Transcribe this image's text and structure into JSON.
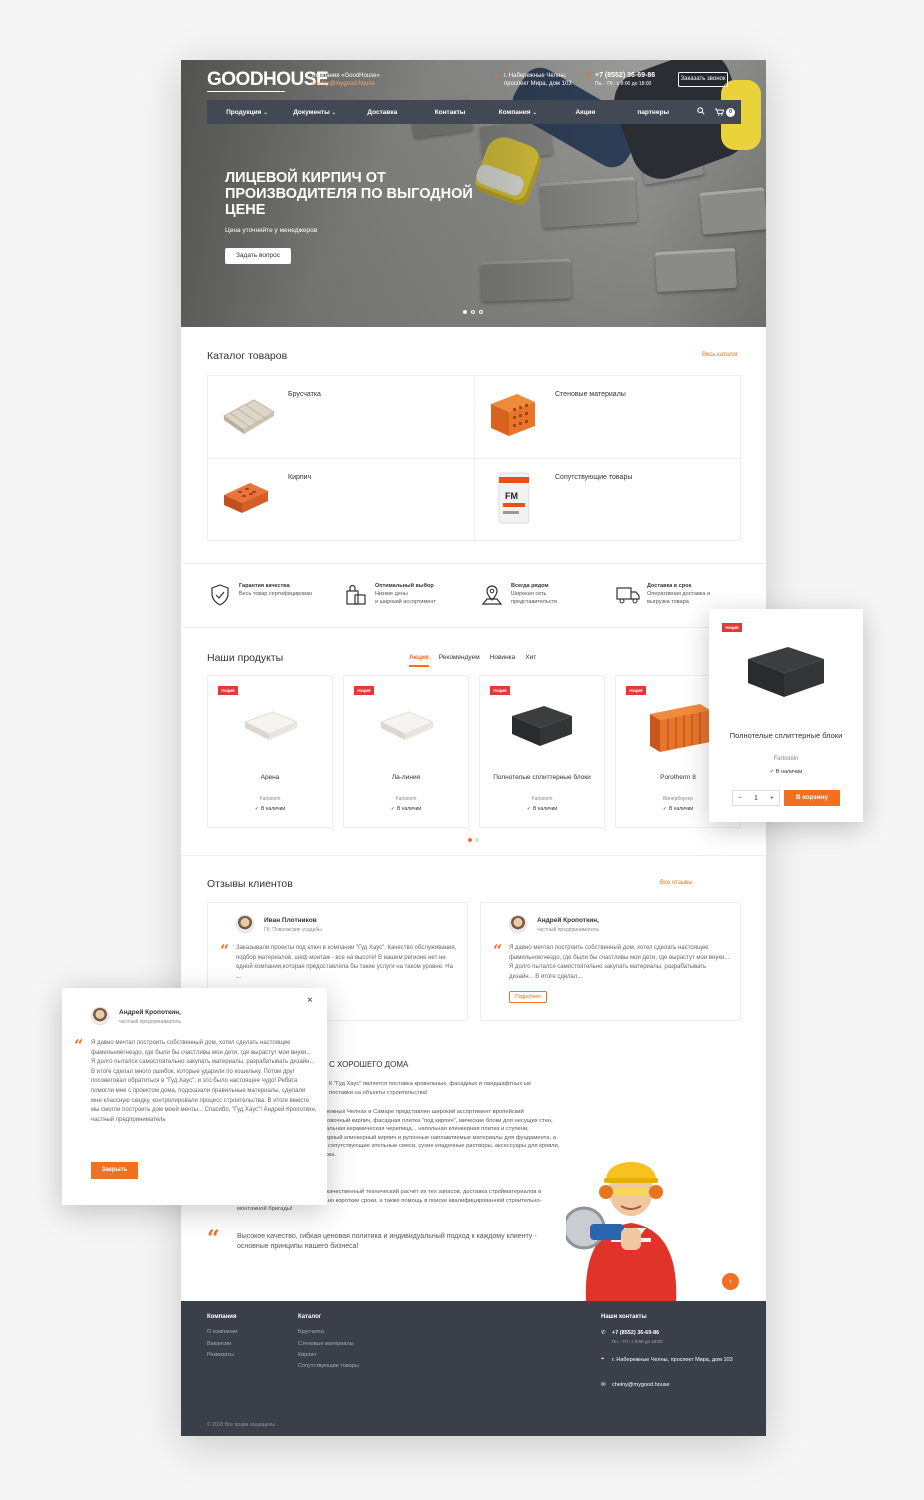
{
  "header": {
    "logo": "GOODHOUSE",
    "company": "Компания «GoodHouse»",
    "email": "chelny@mygood.house",
    "address_line1": "г. Набережные Челны,",
    "address_line2": "проспект Мира, дом 103",
    "phone": "+7 (8552) 36-69-86",
    "hours": "Пн. - Пт.: с 9:00 до 18:00",
    "call_button": "Заказать звонок",
    "cart_count": "0"
  },
  "nav": {
    "items": [
      "Продукция",
      "Документы",
      "Доставка",
      "Контакты",
      "Компания",
      "Акции",
      "партнеры"
    ],
    "dropdown_mark": "⌄"
  },
  "hero": {
    "title": "ЛИЦЕВОЙ КИРПИЧ ОТ ПРОИЗВОДИТЕЛЯ ПО ВЫГОДНОЙ ЦЕНЕ",
    "subtitle": "Цена уточняйте у менеджеров",
    "button": "Задать вопрос"
  },
  "catalog": {
    "title": "Каталог товаров",
    "all_link": "Весь каталог",
    "items": [
      "Брусчатка",
      "Стеновые материалы",
      "Кирпич",
      "Сопутствующие товары"
    ]
  },
  "features": [
    {
      "title": "Гарантия качества",
      "text1": "Весь товар сертифицирован",
      "text2": ""
    },
    {
      "title": "Оптимальный выбор",
      "text1": "Низкие цены",
      "text2": "и широкий ассортимент"
    },
    {
      "title": "Всегда рядом",
      "text1": "Широкая сеть",
      "text2": "представительств"
    },
    {
      "title": "Доставка в срок",
      "text1": "Оперативная доставка и",
      "text2": "выгрузка товара"
    }
  ],
  "products": {
    "title": "Наши продукты",
    "tabs": [
      "Акция",
      "Рекомендуем",
      "Новинка",
      "Хит"
    ],
    "badge": "Акция",
    "in_stock": "В наличии",
    "items": [
      {
        "name": "Арена",
        "brand": "Farbstein"
      },
      {
        "name": "Ла-линия",
        "brand": "Farbstein"
      },
      {
        "name": "Полнотелые сплиттерные блоки",
        "brand": "Farbstein"
      },
      {
        "name": "Porotherm 8",
        "brand": "Винербергер"
      }
    ]
  },
  "popup_product": {
    "badge": "Акция",
    "name": "Полнотелые сплиттерные блоки",
    "brand": "Farbstein",
    "stock": "В наличии",
    "qty": "1",
    "minus": "−",
    "plus": "+",
    "button": "В корзину"
  },
  "reviews": {
    "title": "Отзывы клиентов",
    "all_link": "Все отзывы",
    "more": "Подробнее",
    "items": [
      {
        "name": "Иван Плотников",
        "role": "ГК: Поволжские усадьбы",
        "text": "Заказывали проекты под ключ в компании \"Гуд Хаус\". Качество обслуживания, подбор материалов, шеф монтаж - все на высоте! В нашем регионе нет ни одной компании,которая предоставляла бы такие услуги на таком уровне. На ..."
      },
      {
        "name": "Андрей Кропоткин,",
        "role": "частный предприниматель",
        "text": "Я давно мечтал построить собственный дом, хотел сделать настоящее фамильноегнездо, где были бы счастливы мои дети, где вырастут мои внуки... Я долго пытался самостоятельно закупать материалы, разрабатывать дизайн... В итоге сделал..."
      }
    ]
  },
  "modal": {
    "name": "Андрей Кропоткин,",
    "role": "частный предприниматель",
    "text": "Я давно мечтал построить собственный дом, хотел сделать настоящее фамильноегнездо, где были бы счастливы мои дети, где вырастут мои внуки... Я долго пытался самостоятельно закупать материалы, разрабатывать дизайн... В итоге сделал много ошибок, которые ударили по кошельку. Потом друг посоветовал обратиться в \"Гуд Хаус\", и это было настоящее чудо! Ребята помогли мне с проектом дома, подсказали правильные материалы, сделали мне классную скидку, контролировали процесс строительства. В итоге вместе мы смогли построить дом моей мечты... Спасибо, \"Гуд Хаус\"! Андрей Кропоткин, частный предприниматель",
    "close_button": "Закрыть",
    "close_x": "×"
  },
  "about": {
    "title": "С ХОРОШЕГО ДОМА",
    "p1": "К \"Гуд Хаус\" является поставка кровельных, фасадных и ландшафтных ые поставки на объекты строительства!",
    "p2": "Набережных Челнах и Самаре представлен широкий ассортимент вропейский облицовочный кирпич, фасадная плитка \"под кирпич\", мические блоки для несущих стен, натуральная керамическая черепица, , напольная клинкерная плитка и ступени, тротуарный клинкерный кирпич и рулонные наплавляемые материалы для фундамента, а также сопутствующие ительные смеси, сухие кладочные растворы, аксессуары для кровли, монтажа.",
    "p3": "для клиентов Гуд Хаус являются качественный технический расчёт их тех запасов, доставка стройматериалов в любую точку России в максимально короткие сроки, а также помощь в поиске квалифицированной строительно-монтажной бригады!",
    "quote": "Высокое качество, гибкая ценовая политика и индивидуальный подход к каждому клиенту - основные принципы нашего бизнеса!"
  },
  "footer": {
    "col1_title": "Компания",
    "col1": [
      "О компании",
      "Вакансии",
      "Реквизиты"
    ],
    "col2_title": "Каталог",
    "col2": [
      "Брусчатка",
      "Стеновые материалы",
      "Кирпич",
      "Сопутствующие товары"
    ],
    "col3_title": "Наши контакты",
    "phone": "+7 (8552) 36-69-86",
    "hours": "Пн. - Пт.: с 9:00 до 18:00",
    "address": "г. Набережные Челны, проспект Мира, дом 103",
    "email": "chelny@mygood.house",
    "copyright": "© 2018 Все права защищены."
  },
  "colors": {
    "accent": "#f36f21",
    "nav_bg": "#434855",
    "footer_bg": "#3a3f4a",
    "sale_badge": "#e53935"
  },
  "icons": [
    "location-icon",
    "phone-icon",
    "search-icon",
    "cart-icon",
    "shield-check-icon",
    "bags-icon",
    "map-pin-icon",
    "truck-icon",
    "check-icon",
    "quote-icon",
    "arrow-up-icon",
    "envelope-icon",
    "close-icon"
  ]
}
